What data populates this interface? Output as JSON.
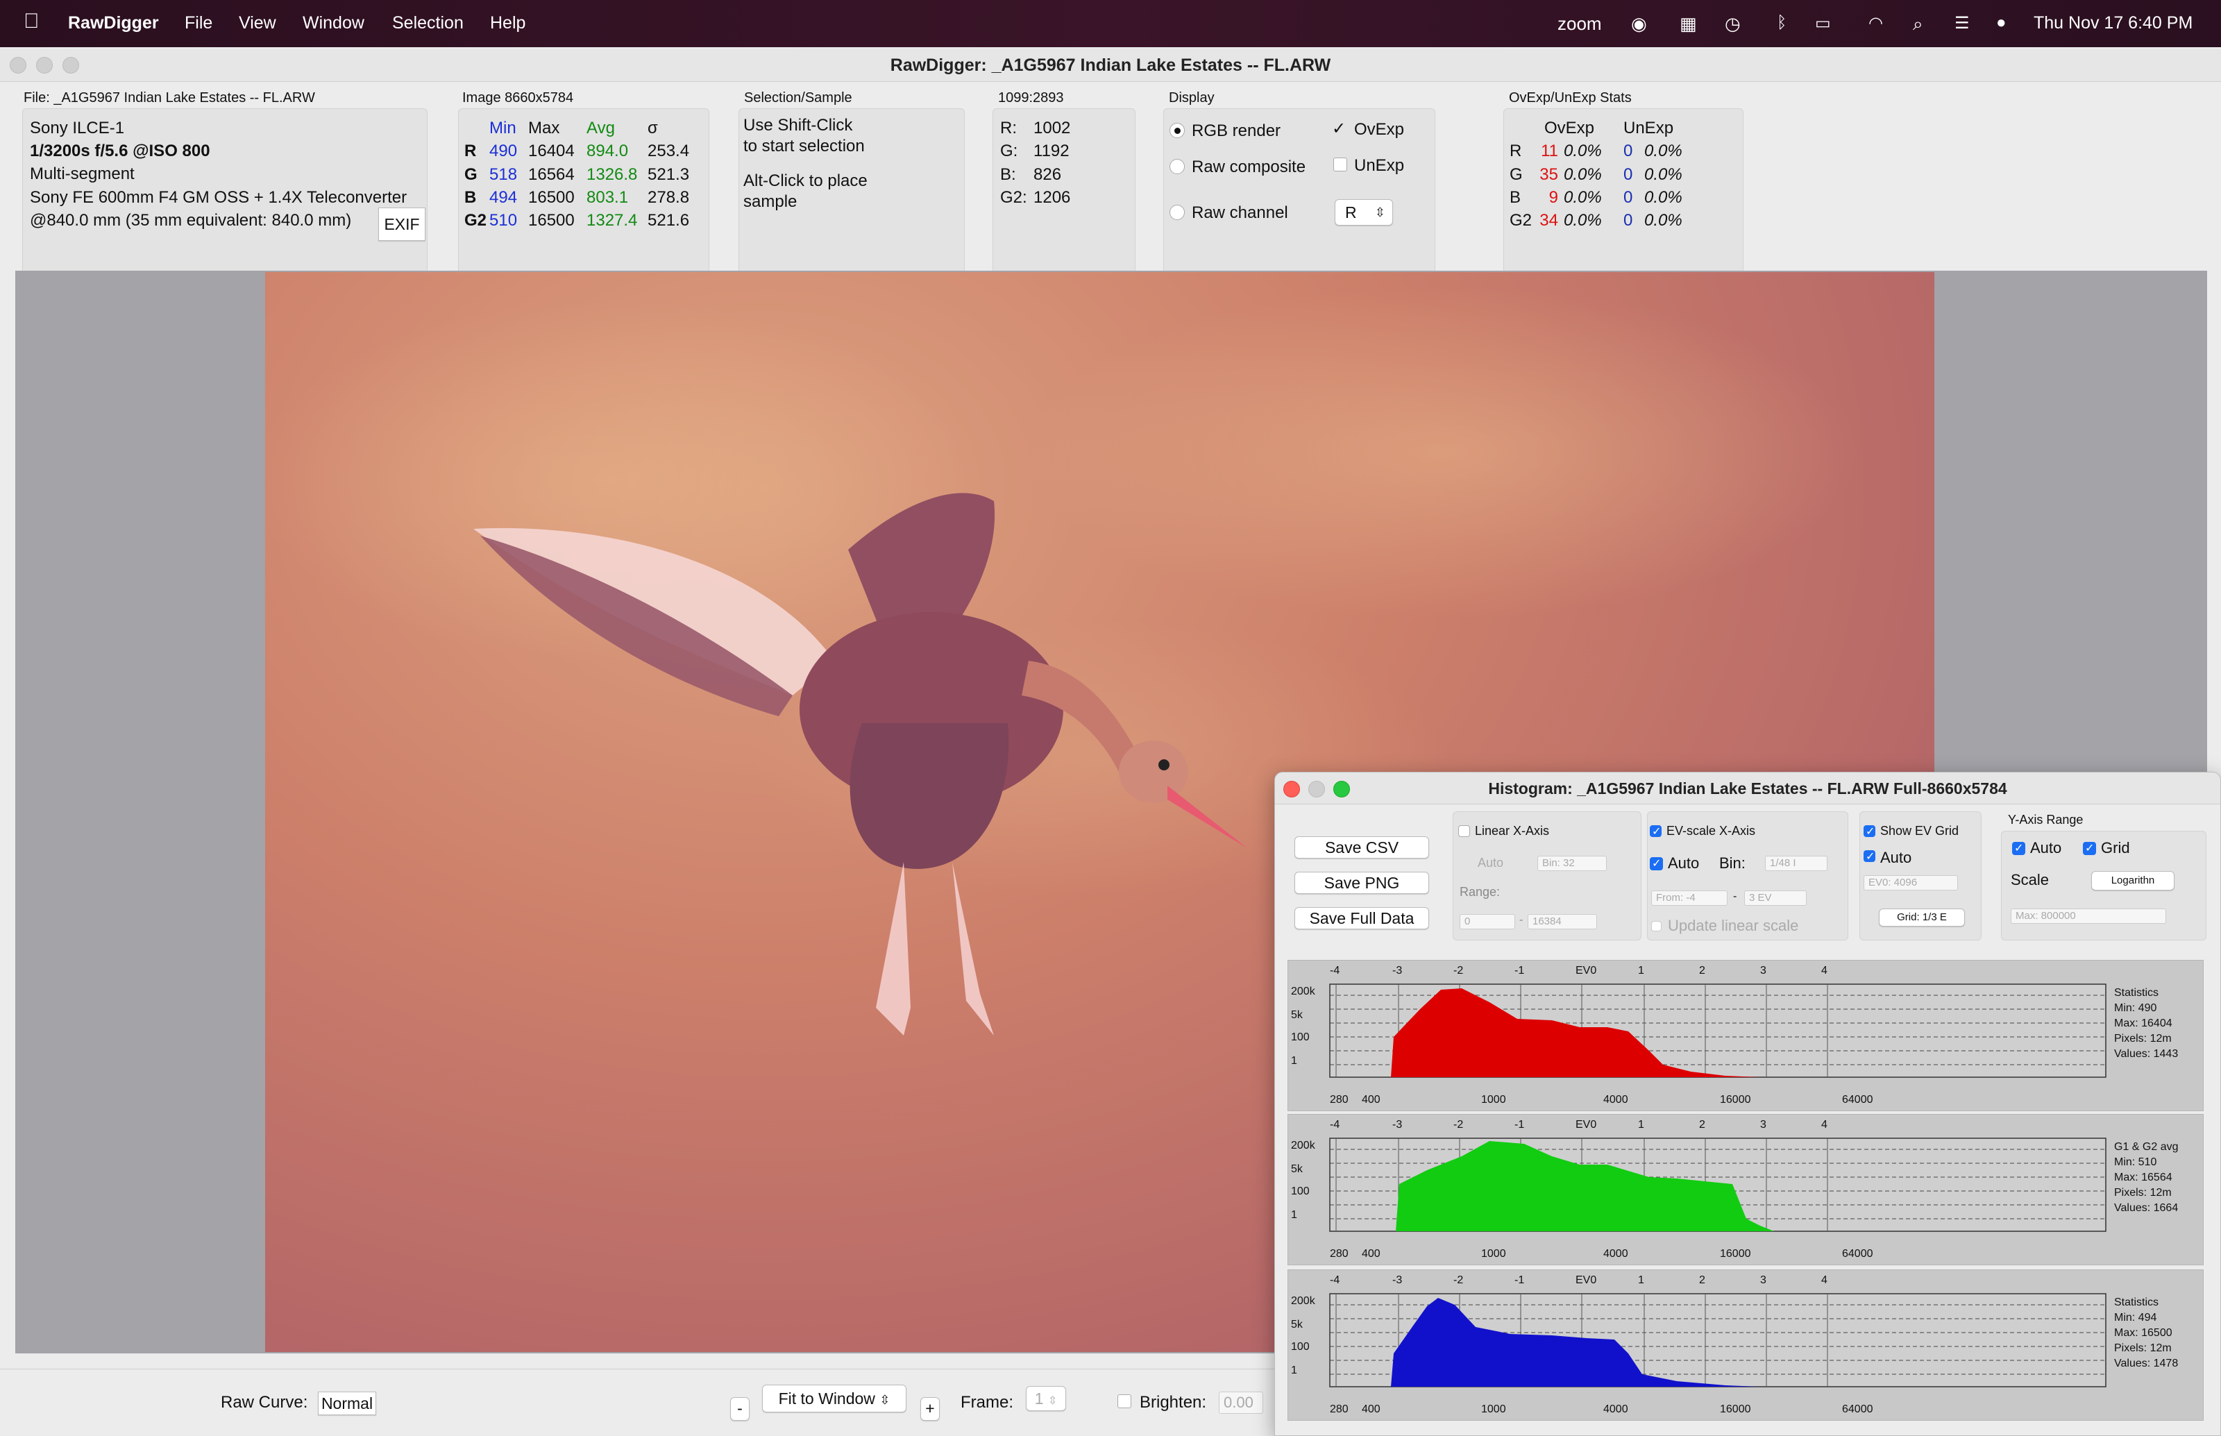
{
  "menubar": {
    "app": "RawDigger",
    "items": [
      "File",
      "View",
      "Window",
      "Selection",
      "Help"
    ],
    "zoom": "zoom",
    "datetime": "Thu Nov 17  6:40 PM"
  },
  "window": {
    "title": "RawDigger: _A1G5967  Indian Lake Estates -- FL.ARW"
  },
  "file": {
    "label": "File: _A1G5967  Indian Lake Estates -- FL.ARW",
    "camera": "Sony ILCE-1",
    "exposure": "1/3200s f/5.6 @ISO 800",
    "metering": "Multi-segment",
    "lens": "Sony FE 600mm F4 GM OSS + 1.4X Teleconverter",
    "focal": "@840.0 mm (35 mm equivalent: 840.0 mm)",
    "exif_button": "EXIF"
  },
  "image_stats": {
    "label": "Image 8660x5784",
    "headers": [
      "Min",
      "Max",
      "Avg",
      "σ"
    ],
    "rows": [
      {
        "ch": "R",
        "min": "490",
        "max": "16404",
        "avg": "894.0",
        "sd": "253.4"
      },
      {
        "ch": "G",
        "min": "518",
        "max": "16564",
        "avg": "1326.8",
        "sd": "521.3"
      },
      {
        "ch": "B",
        "min": "494",
        "max": "16500",
        "avg": "803.1",
        "sd": "278.8"
      },
      {
        "ch": "G2",
        "min": "510",
        "max": "16500",
        "avg": "1327.4",
        "sd": "521.6"
      }
    ]
  },
  "selection": {
    "label": "Selection/Sample",
    "line1": "Use Shift-Click",
    "line2": "to start selection",
    "line3": "Alt-Click to place",
    "line4": "sample"
  },
  "coords": {
    "label": "1099:2893",
    "rows": [
      {
        "ch": "R:",
        "v": "1002"
      },
      {
        "ch": "G:",
        "v": "1192"
      },
      {
        "ch": "B:",
        "v": "826"
      },
      {
        "ch": "G2:",
        "v": "1206"
      }
    ]
  },
  "display": {
    "label": "Display",
    "rgb_render": "RGB render",
    "raw_composite": "Raw composite",
    "raw_channel": "Raw channel",
    "ovexp": "OvExp",
    "unexp": "UnExp",
    "channel_select": "R"
  },
  "ovexp_stats": {
    "label": "OvExp/UnExp Stats",
    "headers": [
      "OvExp",
      "UnExp"
    ],
    "rows": [
      {
        "ch": "R",
        "ov": "11",
        "ovp": "0.0%",
        "un": "0",
        "unp": "0.0%"
      },
      {
        "ch": "G",
        "ov": "35",
        "ovp": "0.0%",
        "un": "0",
        "unp": "0.0%"
      },
      {
        "ch": "B",
        "ov": "9",
        "ovp": "0.0%",
        "un": "0",
        "unp": "0.0%"
      },
      {
        "ch": "G2",
        "ov": "34",
        "ovp": "0.0%",
        "un": "0",
        "unp": "0.0%"
      }
    ]
  },
  "bottom": {
    "raw_curve_label": "Raw Curve:",
    "raw_curve_value": "Normal",
    "minus": "-",
    "fit": "Fit to Window",
    "plus": "+",
    "frame_label": "Frame:",
    "frame_value": "1",
    "brighten_label": "Brighten:",
    "brighten_value": "0.00"
  },
  "histogram": {
    "title": "Histogram: _A1G5967  Indian Lake Estates -- FL.ARW Full-8660x5784",
    "save_csv": "Save CSV",
    "save_png": "Save PNG",
    "save_full": "Save Full Data",
    "linear_x": "Linear X-Axis",
    "auto": "Auto",
    "bin32": "Bin: 32",
    "range": "Range:",
    "range_from": "0",
    "range_to": "16384",
    "ev_x": "EV-scale X-Axis",
    "bin_label": "Bin:",
    "bin_ev": "1/48 I",
    "from": "From: -4",
    "to": "3 EV",
    "update_linear": "Update linear scale",
    "show_ev_grid": "Show EV Grid",
    "ev0": "EV0: 4096",
    "grid_step": "Grid: 1/3 E",
    "y_range": "Y-Axis Range",
    "grid": "Grid",
    "scale": "Scale",
    "scale_value": "Logarithn",
    "max": "Max: 800000",
    "ev_ticks": [
      "-4",
      "-3",
      "-2",
      "-1",
      "EV0",
      "1",
      "2",
      "3",
      "4"
    ],
    "y_ticks": [
      "200k",
      "5k",
      "100",
      "1"
    ],
    "x_ticks": [
      "280",
      "400",
      "1000",
      "4000",
      "16000",
      "64000"
    ],
    "panels": [
      {
        "color": "#dd0000",
        "stats": [
          "Statistics",
          "Min: 490",
          "Max: 16404",
          "Pixels: 12m",
          "Values: 1443"
        ]
      },
      {
        "color": "#11cc11",
        "stats": [
          "G1 & G2 avg",
          "Min: 510",
          "Max: 16564",
          "Pixels: 12m",
          "Values: 1664"
        ]
      },
      {
        "color": "#1111cc",
        "stats": [
          "Statistics",
          "Min: 494",
          "Max: 16500",
          "Pixels: 12m",
          "Values: 1478"
        ]
      }
    ]
  }
}
